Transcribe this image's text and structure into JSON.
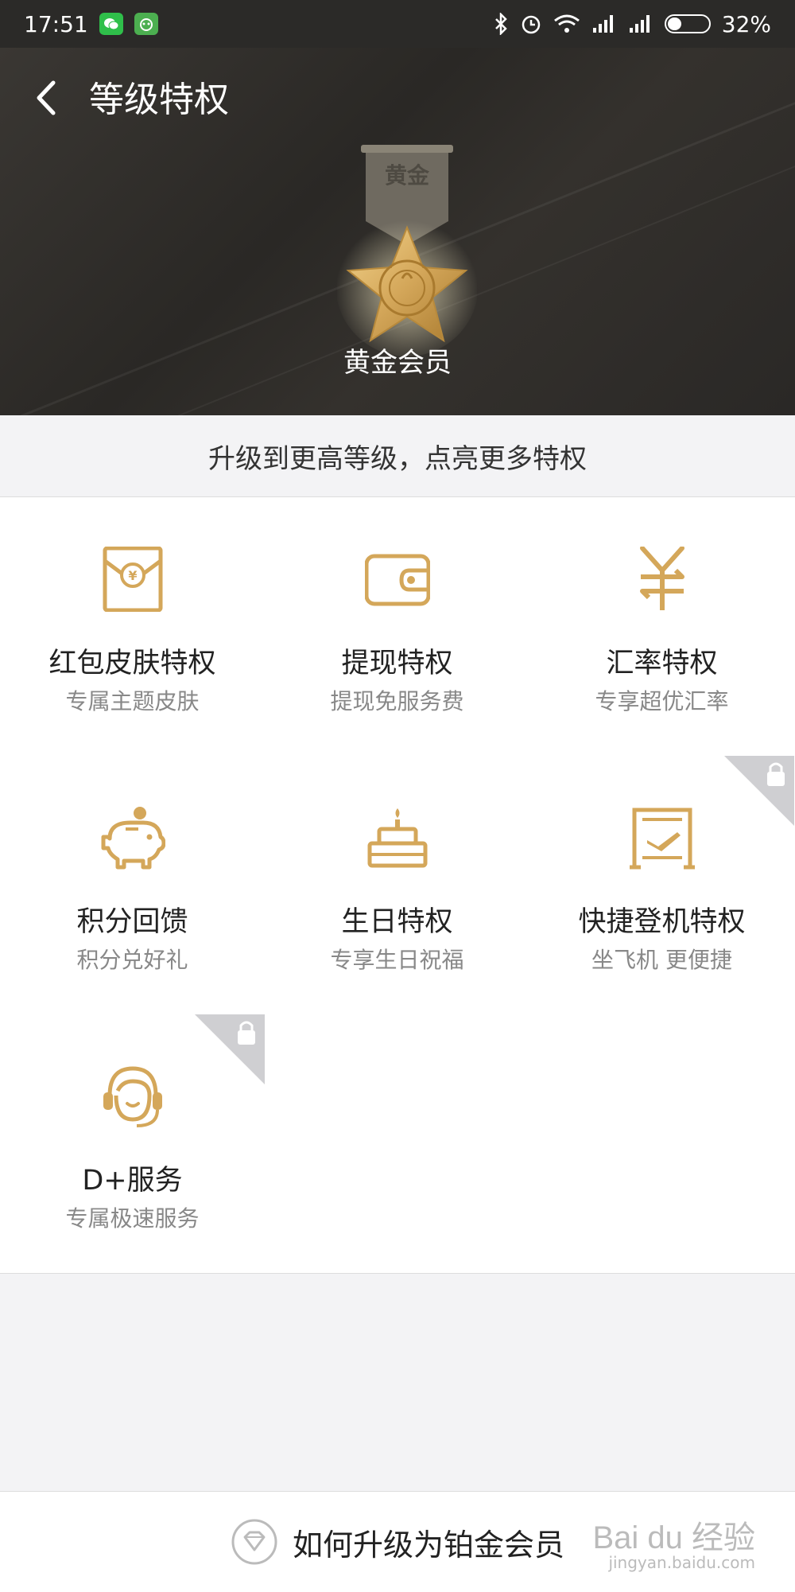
{
  "status_bar": {
    "time": "17:51",
    "battery": "32%",
    "icons": [
      "wechat-icon",
      "app-icon",
      "bluetooth-icon",
      "alarm-icon",
      "wifi-icon",
      "signal-icon",
      "signal-icon",
      "battery-icon"
    ]
  },
  "header": {
    "title": "等级特权",
    "back_icon": "chevron-left-icon",
    "medal_label": "黄金",
    "level_name": "黄金会员"
  },
  "banner": {
    "text": "升级到更高等级，点亮更多特权"
  },
  "privileges": [
    {
      "title": "红包皮肤特权",
      "subtitle": "专属主题皮肤",
      "icon": "red-envelope-icon",
      "locked": false
    },
    {
      "title": "提现特权",
      "subtitle": "提现免服务费",
      "icon": "wallet-icon",
      "locked": false
    },
    {
      "title": "汇率特权",
      "subtitle": "专享超优汇率",
      "icon": "yen-exchange-icon",
      "locked": false
    },
    {
      "title": "积分回馈",
      "subtitle": "积分兑好礼",
      "icon": "piggy-bank-icon",
      "locked": false
    },
    {
      "title": "生日特权",
      "subtitle": "专享生日祝福",
      "icon": "birthday-cake-icon",
      "locked": false
    },
    {
      "title": "快捷登机特权",
      "subtitle": "坐飞机 更便捷",
      "icon": "boarding-gate-icon",
      "locked": true
    },
    {
      "title": "D+服务",
      "subtitle": "专属极速服务",
      "icon": "headset-agent-icon",
      "locked": true
    }
  ],
  "footer": {
    "text": "如何升级为铂金会员",
    "icon": "diamond-icon"
  },
  "watermark": {
    "text": "Bai du 经验",
    "sub": "jingyan.baidu.com"
  },
  "colors": {
    "gold": "#d4a75a",
    "header_bg": "#2f2d2a",
    "page_bg": "#f3f3f5"
  }
}
